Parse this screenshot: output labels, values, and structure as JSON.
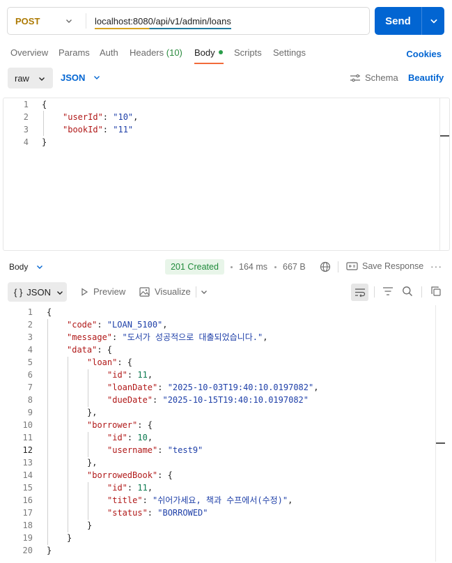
{
  "request": {
    "method": "POST",
    "url": "localhost:8080/api/v1/admin/loans",
    "send_label": "Send"
  },
  "tabs": [
    {
      "label": "Overview"
    },
    {
      "label": "Params"
    },
    {
      "label": "Auth"
    },
    {
      "label": "Headers",
      "count": "(10)"
    },
    {
      "label": "Body",
      "active": true
    },
    {
      "label": "Scripts"
    },
    {
      "label": "Settings"
    }
  ],
  "cookies_label": "Cookies",
  "body_options": {
    "mode": "raw",
    "language": "JSON",
    "schema_label": "Schema",
    "beautify_label": "Beautify"
  },
  "request_body": {
    "line_numbers": [
      "1",
      "2",
      "3",
      "4"
    ],
    "lines": [
      {
        "indent": 0,
        "parts": [
          {
            "t": "p",
            "v": "{"
          }
        ]
      },
      {
        "indent": 1,
        "parts": [
          {
            "t": "k",
            "v": "\"userId\""
          },
          {
            "t": "p",
            "v": ": "
          },
          {
            "t": "s",
            "v": "\"10\""
          },
          {
            "t": "p",
            "v": ","
          }
        ]
      },
      {
        "indent": 1,
        "parts": [
          {
            "t": "k",
            "v": "\"bookId\""
          },
          {
            "t": "p",
            "v": ": "
          },
          {
            "t": "s",
            "v": "\"11\""
          }
        ]
      },
      {
        "indent": 0,
        "parts": [
          {
            "t": "p",
            "v": "}"
          }
        ]
      }
    ]
  },
  "response_meta": {
    "section_label": "Body",
    "status": "201 Created",
    "time": "164 ms",
    "size": "667 B",
    "save_label": "Save Response",
    "more_label": "···"
  },
  "response_tools": {
    "format": "JSON",
    "format_prefix": "{ }",
    "preview_label": "Preview",
    "visualize_label": "Visualize"
  },
  "response_body": {
    "current_line": 12,
    "line_numbers": [
      "1",
      "2",
      "3",
      "4",
      "5",
      "6",
      "7",
      "8",
      "9",
      "10",
      "11",
      "12",
      "13",
      "14",
      "15",
      "16",
      "17",
      "18",
      "19",
      "20"
    ],
    "lines": [
      {
        "indent": 0,
        "parts": [
          {
            "t": "p",
            "v": "{"
          }
        ]
      },
      {
        "indent": 1,
        "parts": [
          {
            "t": "k",
            "v": "\"code\""
          },
          {
            "t": "p",
            "v": ": "
          },
          {
            "t": "s",
            "v": "\"LOAN_5100\""
          },
          {
            "t": "p",
            "v": ","
          }
        ]
      },
      {
        "indent": 1,
        "parts": [
          {
            "t": "k",
            "v": "\"message\""
          },
          {
            "t": "p",
            "v": ": "
          },
          {
            "t": "s",
            "v": "\"도서가 성공적으로 대출되었습니다.\""
          },
          {
            "t": "p",
            "v": ","
          }
        ]
      },
      {
        "indent": 1,
        "parts": [
          {
            "t": "k",
            "v": "\"data\""
          },
          {
            "t": "p",
            "v": ": {"
          }
        ]
      },
      {
        "indent": 2,
        "parts": [
          {
            "t": "k",
            "v": "\"loan\""
          },
          {
            "t": "p",
            "v": ": {"
          }
        ]
      },
      {
        "indent": 3,
        "parts": [
          {
            "t": "k",
            "v": "\"id\""
          },
          {
            "t": "p",
            "v": ": "
          },
          {
            "t": "n",
            "v": "11"
          },
          {
            "t": "p",
            "v": ","
          }
        ]
      },
      {
        "indent": 3,
        "parts": [
          {
            "t": "k",
            "v": "\"loanDate\""
          },
          {
            "t": "p",
            "v": ": "
          },
          {
            "t": "s",
            "v": "\"2025-10-03T19:40:10.0197082\""
          },
          {
            "t": "p",
            "v": ","
          }
        ]
      },
      {
        "indent": 3,
        "parts": [
          {
            "t": "k",
            "v": "\"dueDate\""
          },
          {
            "t": "p",
            "v": ": "
          },
          {
            "t": "s",
            "v": "\"2025-10-15T19:40:10.0197082\""
          }
        ]
      },
      {
        "indent": 2,
        "parts": [
          {
            "t": "p",
            "v": "},"
          }
        ]
      },
      {
        "indent": 2,
        "parts": [
          {
            "t": "k",
            "v": "\"borrower\""
          },
          {
            "t": "p",
            "v": ": {"
          }
        ]
      },
      {
        "indent": 3,
        "parts": [
          {
            "t": "k",
            "v": "\"id\""
          },
          {
            "t": "p",
            "v": ": "
          },
          {
            "t": "n",
            "v": "10"
          },
          {
            "t": "p",
            "v": ","
          }
        ]
      },
      {
        "indent": 3,
        "parts": [
          {
            "t": "k",
            "v": "\"username\""
          },
          {
            "t": "p",
            "v": ": "
          },
          {
            "t": "s",
            "v": "\"test9\""
          }
        ]
      },
      {
        "indent": 2,
        "parts": [
          {
            "t": "p",
            "v": "},"
          }
        ]
      },
      {
        "indent": 2,
        "parts": [
          {
            "t": "k",
            "v": "\"borrowedBook\""
          },
          {
            "t": "p",
            "v": ": {"
          }
        ]
      },
      {
        "indent": 3,
        "parts": [
          {
            "t": "k",
            "v": "\"id\""
          },
          {
            "t": "p",
            "v": ": "
          },
          {
            "t": "n",
            "v": "11"
          },
          {
            "t": "p",
            "v": ","
          }
        ]
      },
      {
        "indent": 3,
        "parts": [
          {
            "t": "k",
            "v": "\"title\""
          },
          {
            "t": "p",
            "v": ": "
          },
          {
            "t": "s",
            "v": "\"쉬어가세요, 책과 수프에서(수정)\""
          },
          {
            "t": "p",
            "v": ","
          }
        ]
      },
      {
        "indent": 3,
        "parts": [
          {
            "t": "k",
            "v": "\"status\""
          },
          {
            "t": "p",
            "v": ": "
          },
          {
            "t": "s",
            "v": "\"BORROWED\""
          }
        ]
      },
      {
        "indent": 2,
        "parts": [
          {
            "t": "p",
            "v": "}"
          }
        ]
      },
      {
        "indent": 1,
        "parts": [
          {
            "t": "p",
            "v": "}"
          }
        ]
      },
      {
        "indent": 0,
        "parts": [
          {
            "t": "p",
            "v": "}"
          }
        ]
      }
    ]
  },
  "colors": {
    "method": "#ad7a03",
    "send": "#0265d2",
    "accent_link": "#0265d2",
    "active_tab_underline": "#f26b3a",
    "status_ok": "#1f8a3a",
    "json_key": "#b01818",
    "json_string": "#1e3fa8",
    "json_number": "#0d7a50"
  }
}
